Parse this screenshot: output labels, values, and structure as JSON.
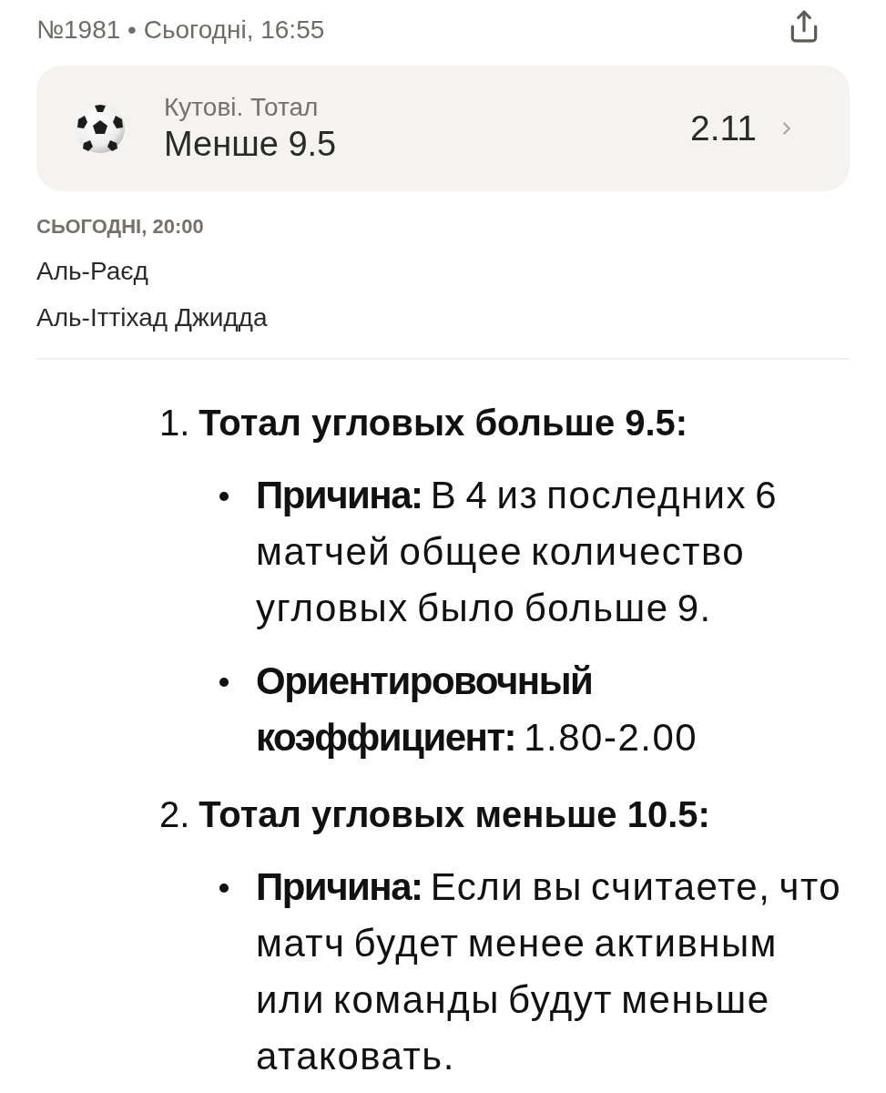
{
  "header": {
    "meta": "№1981 • Сьогодні, 16:55"
  },
  "bet_card": {
    "market": "Кутові. Тотал",
    "selection": "Менше 9.5",
    "odds": "2.11"
  },
  "match": {
    "time": "СЬОГОДНІ, 20:00",
    "teams": [
      "Аль-Раєд",
      "Аль-Іттіхад Джидда"
    ]
  },
  "analysis": [
    {
      "number": "1.",
      "title": "Тотал угловых больше 9.5:",
      "points": [
        "**Причина:** В 4 из последних 6 матчей общее количество угловых было больше 9.",
        "**Ориентировочный коэффициент:** 1.80-2.00"
      ]
    },
    {
      "number": "2.",
      "title": "Тотал угловых меньше 10.5:",
      "points": [
        "**Причина:** Если вы считаете, что матч будет менее активным или команды будут меньше атаковать."
      ]
    }
  ]
}
